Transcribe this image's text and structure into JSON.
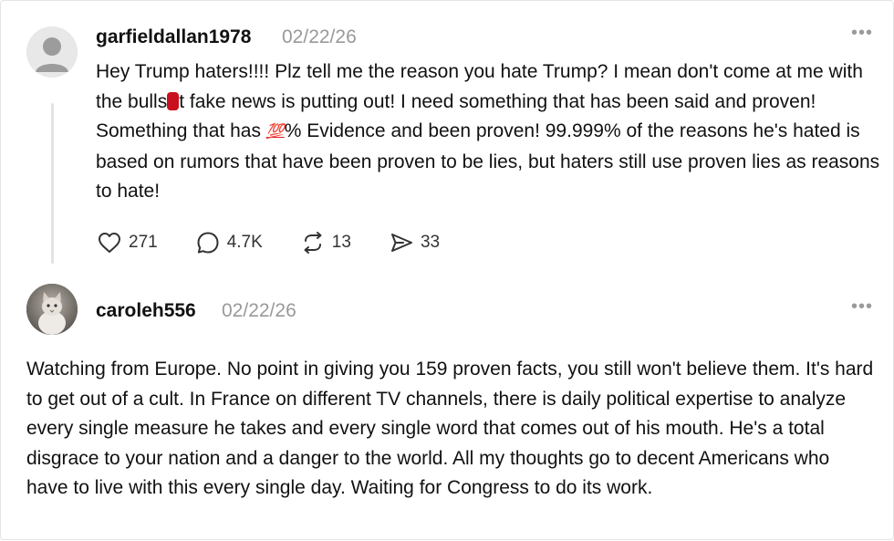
{
  "posts": [
    {
      "username": "garfieldallan1978",
      "timestamp": "02/22/26",
      "more_label": "•••",
      "text_parts": [
        "Hey Trump haters!!!! Plz tell me the reason you hate Trump? I mean don't come at me with the bulls",
        "t fake news is putting out! I need something that has been said and proven! Something that has ",
        "% Evidence and been proven! 99.999% of the reasons he's hated is based on rumors that have been proven to be lies, but haters still use proven lies as reasons to hate!"
      ],
      "hundred_emoji": "💯",
      "actions": {
        "like_count": "271",
        "comment_count": "4.7K",
        "repost_count": "13",
        "share_count": "33"
      }
    },
    {
      "username": "caroleh556",
      "timestamp": "02/22/26",
      "more_label": "•••",
      "text": "Watching from Europe. No point in giving you 159 proven facts, you still won't believe them. It's hard to get out of a cult. In France on different TV channels, there is daily political expertise to analyze every single measure he takes and every single word that comes out of his mouth. He's a total disgrace to your nation and a danger to the world. All my thoughts go to decent Americans who have to live with this every single day. Waiting for Congress to do its work."
    }
  ],
  "colors": {
    "text": "#111111",
    "muted": "#999999",
    "redaction": "#c8101e",
    "thread_line": "#e3e3e3"
  },
  "icons": [
    "heart-icon",
    "comment-icon",
    "repost-icon",
    "share-icon",
    "more-icon",
    "default-avatar-icon"
  ]
}
